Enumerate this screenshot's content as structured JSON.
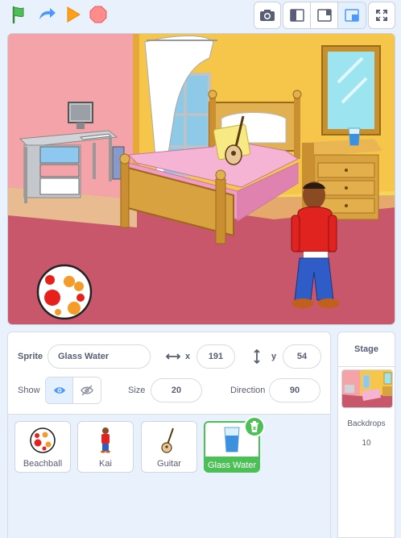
{
  "toolbar": {
    "green_flag": "green-flag-icon",
    "turbo": "turbo-icon",
    "play": "play-icon",
    "stop": "stop-icon",
    "screenshot": "camera-icon",
    "layout_small": "small-stage-icon",
    "layout_normal": "normal-stage-icon",
    "layout_active": "small-stage-mode",
    "fullscreen": "fullscreen-icon"
  },
  "sprite_info": {
    "sprite_label": "Sprite",
    "sprite_name": "Glass Water",
    "x_label": "x",
    "x_value": "191",
    "y_label": "y",
    "y_value": "54",
    "show_label": "Show",
    "size_label": "Size",
    "size_value": "20",
    "direction_label": "Direction",
    "direction_value": "90"
  },
  "sprites": [
    {
      "name": "Beachball",
      "selected": false
    },
    {
      "name": "Kai",
      "selected": false
    },
    {
      "name": "Guitar",
      "selected": false
    },
    {
      "name": "Glass Water",
      "selected": true
    }
  ],
  "stage_panel": {
    "title": "Stage",
    "backdrops_label": "Backdrops",
    "backdrops_count": "10"
  },
  "colors": {
    "accent": "#4cbf56",
    "blue": "#4c97ff",
    "text": "#575e75"
  }
}
